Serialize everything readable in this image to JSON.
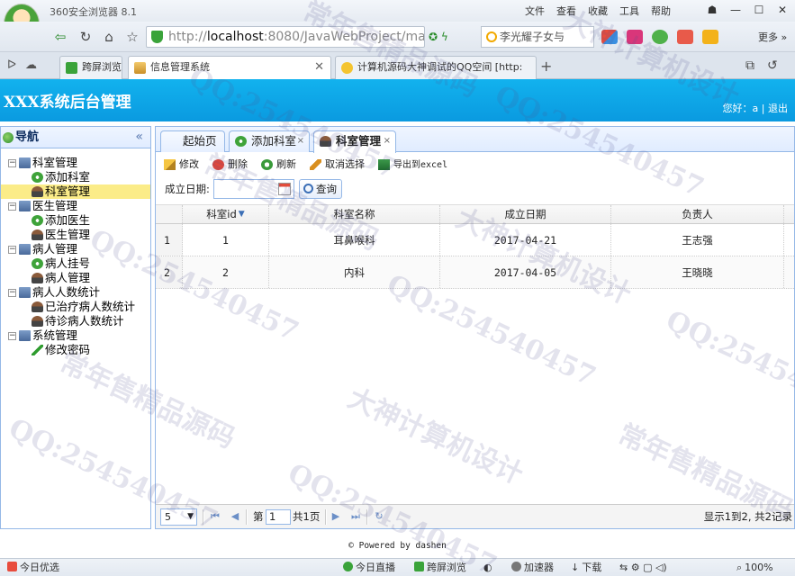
{
  "browser": {
    "name": "360安全浏览器 8.1",
    "menu": [
      "文件",
      "查看",
      "收藏",
      "工具",
      "帮助"
    ],
    "url_prefix": "http://",
    "url_host": "localhost",
    "url_rest": ":8080/JavaWebProject/main.",
    "search_text": "李光耀子女与",
    "more_label": "更多",
    "tabs": [
      {
        "label": "跨屏浏览"
      },
      {
        "label": "信息管理系统"
      },
      {
        "label": "计算机源码大神调试的QQ空间 [http:"
      }
    ]
  },
  "app": {
    "title": "XXX系统后台管理",
    "user_text": "您好：a",
    "logout_label": "退出"
  },
  "sidebar": {
    "title": "导航",
    "collapse_icon": "double-chevron-left",
    "groups": [
      {
        "label": "科室管理",
        "items": [
          "添加科室",
          "科室管理"
        ]
      },
      {
        "label": "医生管理",
        "items": [
          "添加医生",
          "医生管理"
        ]
      },
      {
        "label": "病人管理",
        "items": [
          "病人挂号",
          "病人管理"
        ]
      },
      {
        "label": "病人人数统计",
        "items": [
          "已治疗病人数统计",
          "待诊病人数统计"
        ]
      },
      {
        "label": "系统管理",
        "items": [
          "修改密码"
        ]
      }
    ],
    "selected": "科室管理"
  },
  "main": {
    "tabs": [
      {
        "label": "起始页"
      },
      {
        "label": "添加科室"
      },
      {
        "label": "科室管理"
      }
    ],
    "actions": [
      "修改",
      "删除",
      "刷新",
      "取消选择",
      "导出到excel"
    ],
    "filter_label": "成立日期:",
    "date_value": "",
    "query_label": "查询",
    "columns": [
      "科室id",
      "科室名称",
      "成立日期",
      "负责人"
    ],
    "rows": [
      {
        "num": "1",
        "id": "1",
        "name": "耳鼻喉科",
        "date": "2017-04-21",
        "head": "王志强"
      },
      {
        "num": "2",
        "id": "2",
        "name": "内科",
        "date": "2017-04-05",
        "head": "王晓晓"
      }
    ],
    "pager": {
      "page_size": "5",
      "page_prefix": "第",
      "page_value": "1",
      "page_total": "共1页",
      "info": "显示1到2, 共2记录"
    }
  },
  "footer": "© Powered by dashen",
  "statusbar": {
    "left": "今日优选",
    "items": [
      "今日直播",
      "跨屏浏览",
      "加速器",
      "下载",
      "100%"
    ]
  },
  "watermark": {
    "texts": [
      "常年售精品源码",
      "大神计算机设计",
      "QQ:254540457"
    ]
  },
  "colors": {
    "header": "#0aa6e8",
    "panel_border": "#95b8e7",
    "selected": "#fbec88"
  }
}
